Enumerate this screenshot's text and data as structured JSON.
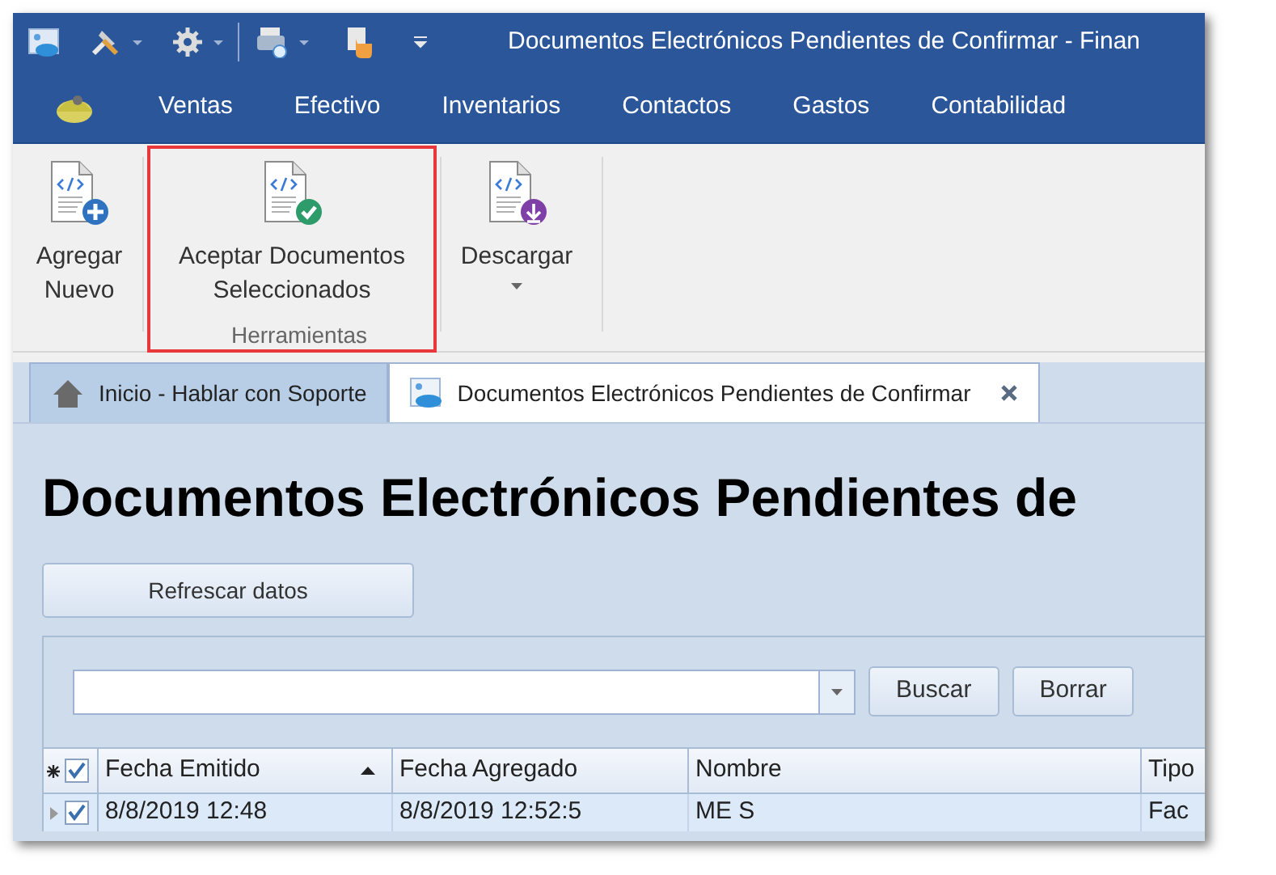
{
  "title_bar": {
    "title": "Documentos Electrónicos Pendientes de Confirmar - Finan"
  },
  "menu": [
    {
      "label": "Ventas"
    },
    {
      "label": "Efectivo"
    },
    {
      "label": "Inventarios"
    },
    {
      "label": "Contactos"
    },
    {
      "label": "Gastos"
    },
    {
      "label": "Contabilidad"
    }
  ],
  "ribbon": {
    "buttons": [
      {
        "label": "Agregar Nuevo",
        "kind": "add",
        "highlighted": false,
        "dropdown": false
      },
      {
        "label": "Aceptar Documentos Seleccionados",
        "kind": "accept",
        "highlighted": true,
        "dropdown": false
      },
      {
        "label": "Descargar",
        "kind": "download",
        "highlighted": false,
        "dropdown": true
      }
    ],
    "group_label": "Herramientas"
  },
  "tabs": [
    {
      "label": "Inicio - Hablar con Soporte",
      "kind": "home",
      "selected": false,
      "closable": false
    },
    {
      "label": "Documentos Electrónicos Pendientes de Confirmar",
      "kind": "document",
      "selected": true,
      "closable": true
    }
  ],
  "page": {
    "heading": "Documentos Electrónicos Pendientes de",
    "refresh_button": "Refrescar datos",
    "search_buttons": [
      "Buscar",
      "Borrar"
    ],
    "table": {
      "all_checked": true,
      "first_column_sorted_ascending": true,
      "columns": [
        {
          "label": "Fecha Emitido"
        },
        {
          "label": "Fecha Agregado"
        },
        {
          "label": "Nombre"
        },
        {
          "label": "Tipo"
        }
      ],
      "rows": [
        {
          "checked": true,
          "cells": [
            "8/8/2019 12:48",
            "8/8/2019 12:52:5",
            "ME S",
            "Fac"
          ]
        }
      ]
    }
  }
}
